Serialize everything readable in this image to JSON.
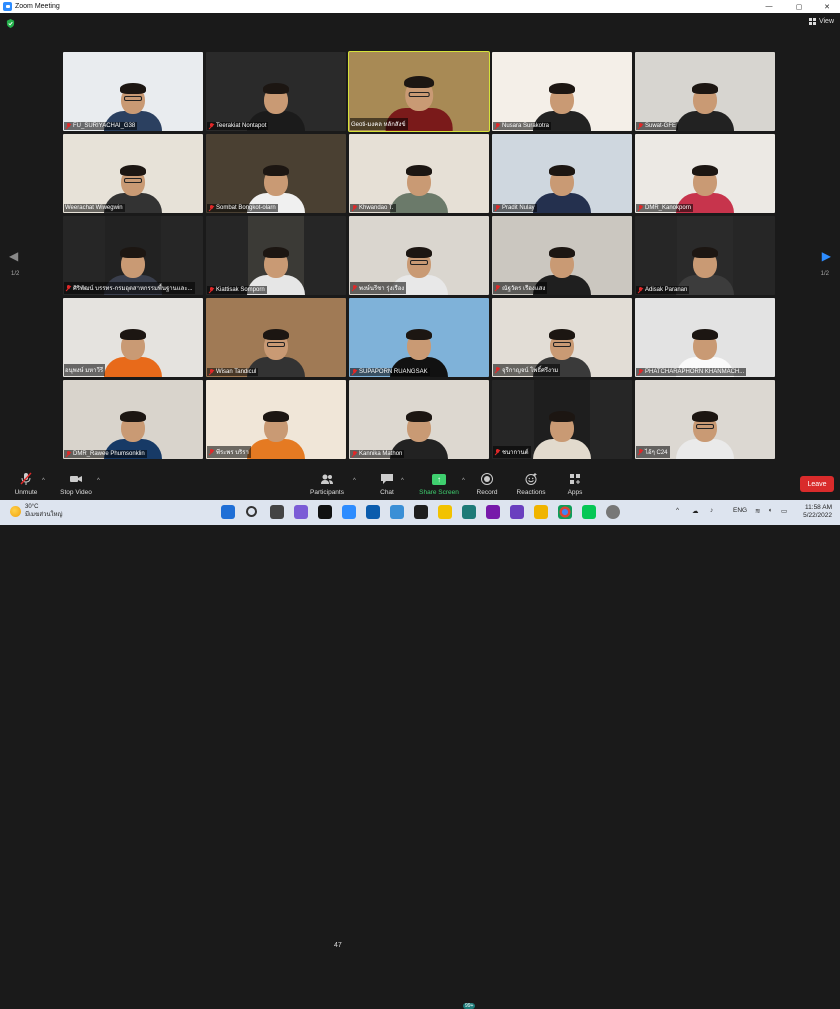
{
  "window": {
    "title": "Zoom Meeting",
    "controls": [
      "—",
      "▢",
      "✕"
    ]
  },
  "meeting": {
    "view_label": "View",
    "page_left": "1/2",
    "page_right": "1/2",
    "participants": [
      {
        "name": "FU_SURIYACHAI_G38",
        "muted": true
      },
      {
        "name": "Teerakiat Nontapot",
        "muted": true
      },
      {
        "name": "Geoti-มงคล หลักสังข์",
        "muted": false,
        "active": true
      },
      {
        "name": "Nusara Surakotra",
        "muted": true
      },
      {
        "name": "Suwat-GFE",
        "muted": true
      },
      {
        "name": "Weerachat Wiwegwin",
        "muted": false
      },
      {
        "name": "Sombat Bongkot-olarn",
        "muted": true
      },
      {
        "name": "Khwandao T.",
        "muted": true
      },
      {
        "name": "Pradit Nulay",
        "muted": true
      },
      {
        "name": "DMR_Kanokporn",
        "muted": true
      },
      {
        "name": "ศิริพัฒน์ บรรทร-กรมอุตสาหกรรมพื้นฐานและ...",
        "muted": true
      },
      {
        "name": "Kiattisak Somporn",
        "muted": true
      },
      {
        "name": "พงษ์นรีชา รุ่งเรือง",
        "muted": true
      },
      {
        "name": "ณัฐวัตร เรืองแสง",
        "muted": true
      },
      {
        "name": "Adisak Paranan",
        "muted": true
      },
      {
        "name": "อนุพงษ์ มหาวีรี",
        "muted": false
      },
      {
        "name": "Wisan Tandicul",
        "muted": true
      },
      {
        "name": "SUPAPORN RUANGSAK",
        "muted": true
      },
      {
        "name": "จุรีกาญจน์ โพธิ์ศรีงาม",
        "muted": true
      },
      {
        "name": "PHATCHARAPHORN KHANMACH...",
        "muted": true
      },
      {
        "name": "DMR_Rawee Phumsonklin",
        "muted": true
      },
      {
        "name": "พีระพร บริรา",
        "muted": true
      },
      {
        "name": "Kannika Mathon",
        "muted": true
      },
      {
        "name": "ชนากานต์",
        "muted": true
      },
      {
        "name": "ไอ้ๆ C24",
        "muted": true
      }
    ]
  },
  "toolbar": {
    "unmute": "Unmute",
    "stop_video": "Stop Video",
    "participants": "Participants",
    "participants_count": "47",
    "chat": "Chat",
    "share_screen": "Share Screen",
    "record": "Record",
    "reactions": "Reactions",
    "apps": "Apps",
    "leave": "Leave"
  },
  "taskbar": {
    "weather_temp": "30°C",
    "weather_desc": "มีเมฆส่วนใหญ่",
    "lang": "ENG",
    "time": "11:58 AM",
    "date": "5/22/2022",
    "badge": "99+"
  },
  "colors": {
    "accent_blue": "#2d8cff",
    "leave_red": "#d92b2b",
    "share_green": "#3fcf6f",
    "active_outline": "#d6e23a"
  }
}
